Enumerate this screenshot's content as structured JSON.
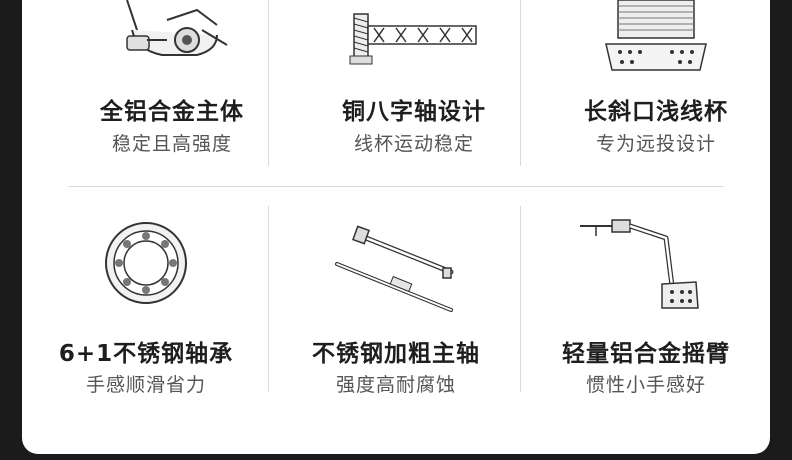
{
  "features": [
    {
      "icon": "spinning-reel-body-icon",
      "title": "全铝合金主体",
      "subtitle": "稳定且高强度"
    },
    {
      "icon": "copper-crossing-gear-icon",
      "title": "铜八字轴设计",
      "subtitle": "线杯运动稳定"
    },
    {
      "icon": "long-taper-spool-icon",
      "title": "长斜口浅线杯",
      "subtitle": "专为远投设计"
    },
    {
      "icon": "ball-bearing-icon",
      "title": "6+1不锈钢轴承",
      "subtitle": "手感顺滑省力"
    },
    {
      "icon": "main-shaft-icon",
      "title": "不锈钢加粗主轴",
      "subtitle": "强度高耐腐蚀"
    },
    {
      "icon": "reel-handle-arm-icon",
      "title": "轻量铝合金摇臂",
      "subtitle": "惯性小手感好"
    }
  ]
}
